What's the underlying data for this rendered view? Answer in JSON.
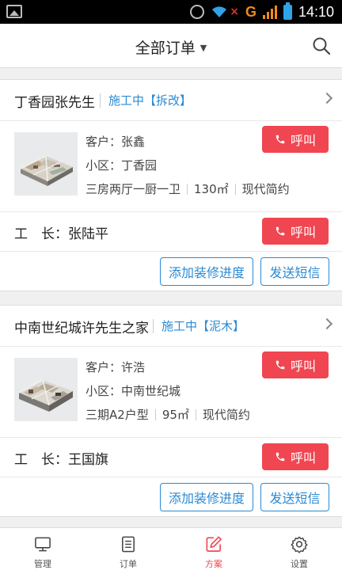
{
  "status_bar": {
    "time": "14:10",
    "network": "G"
  },
  "header": {
    "title": "全部订单",
    "caret": "▼"
  },
  "colors": {
    "accent_red": "#f04651",
    "accent_blue": "#2a8ad4"
  },
  "orders": [
    {
      "name": "丁香园张先生",
      "status": "施工中【拆改】",
      "customer": "客户：张鑫",
      "community": "小区：丁香园",
      "layout": "三房两厅一厨一卫",
      "area": "130㎡",
      "style": "现代简约",
      "call_label": "呼叫",
      "foreman_label": "工　长：张陆平",
      "foreman_call_label": "呼叫",
      "add_progress_label": "添加装修进度",
      "send_sms_label": "发送短信"
    },
    {
      "name": "中南世纪城许先生之家",
      "status": "施工中【泥木】",
      "customer": "客户：许浩",
      "community": "小区：中南世纪城",
      "layout": "三期A2户型",
      "area": "95㎡",
      "style": "现代简约",
      "call_label": "呼叫",
      "foreman_label": "工　长：王国旗",
      "foreman_call_label": "呼叫",
      "add_progress_label": "添加装修进度",
      "send_sms_label": "发送短信"
    }
  ],
  "tabbar": {
    "items": [
      {
        "label": "管理",
        "icon": "monitor-icon"
      },
      {
        "label": "订单",
        "icon": "document-icon"
      },
      {
        "label": "方案",
        "icon": "edit-icon"
      },
      {
        "label": "设置",
        "icon": "gear-icon"
      }
    ],
    "active_index": 2
  }
}
